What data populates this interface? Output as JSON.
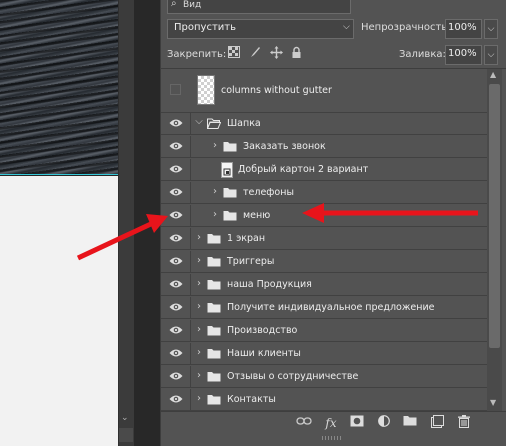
{
  "canvas": {
    "scroll_down_glyph": "⌄"
  },
  "panel": {
    "filter": {
      "label": "Вид",
      "icon": "search-icon"
    },
    "blend_mode": {
      "value": "Пропустить",
      "icon": "chevron-down-icon"
    },
    "opacity": {
      "label": "Непрозрачность:",
      "value": "100%"
    },
    "lock": {
      "label": "Закрепить:",
      "icons": [
        "lock-transparent-pixels-icon",
        "lock-image-pixels-icon",
        "lock-position-icon",
        "lock-all-icon"
      ]
    },
    "fill": {
      "label": "Заливка:",
      "value": "100%"
    }
  },
  "layers": {
    "top_layer": {
      "name": "columns without gutter",
      "visible": false
    },
    "rows": [
      {
        "name": "Шапка",
        "type": "group",
        "expanded": true,
        "indent": 0,
        "visible": true
      },
      {
        "name": "Заказать звонок",
        "type": "group",
        "expanded": false,
        "indent": 1,
        "visible": true
      },
      {
        "name": "Добрый картон 2 вариант",
        "type": "smart-object",
        "indent": 1,
        "visible": true
      },
      {
        "name": "телефоны",
        "type": "group",
        "expanded": false,
        "indent": 1,
        "visible": true
      },
      {
        "name": "меню",
        "type": "group",
        "expanded": false,
        "indent": 1,
        "visible": true
      },
      {
        "name": "1 экран",
        "type": "group",
        "expanded": false,
        "indent": 0,
        "visible": true
      },
      {
        "name": "Триггеры",
        "type": "group",
        "expanded": false,
        "indent": 0,
        "visible": true
      },
      {
        "name": "наша Продукция",
        "type": "group",
        "expanded": false,
        "indent": 0,
        "visible": true
      },
      {
        "name": "Получите индивидуальное предложение",
        "type": "group",
        "expanded": false,
        "indent": 0,
        "visible": true
      },
      {
        "name": "Производство",
        "type": "group",
        "expanded": false,
        "indent": 0,
        "visible": true
      },
      {
        "name": "Наши клиенты",
        "type": "group",
        "expanded": false,
        "indent": 0,
        "visible": true
      },
      {
        "name": "Отзывы о сотрудничестве",
        "type": "group",
        "expanded": false,
        "indent": 0,
        "visible": true
      },
      {
        "name": "Контакты",
        "type": "group",
        "expanded": false,
        "indent": 0,
        "visible": true
      }
    ]
  },
  "toolbar": {
    "icons": [
      "link-layers-icon",
      "layer-style-fx-icon",
      "add-mask-icon",
      "adjustment-layer-icon",
      "new-group-icon",
      "new-layer-icon",
      "delete-layer-icon"
    ],
    "fx_label": "fx"
  },
  "annotations": {
    "arrow_color": "#e8141b"
  },
  "colors": {
    "panel_bg": "#535353",
    "guide": "#35c7d6"
  }
}
